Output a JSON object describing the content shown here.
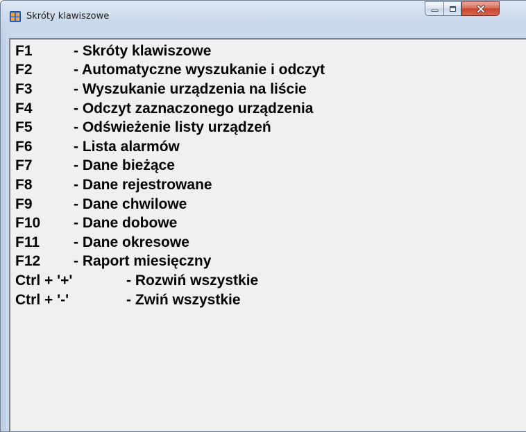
{
  "window": {
    "title": "Skróty klawiszowe",
    "icon": "app-window-icon"
  },
  "caption_buttons": {
    "minimize": "minimize-icon",
    "maximize": "maximize-icon",
    "close": "close-icon"
  },
  "shortcuts": [
    {
      "key": "F1",
      "description": "- Skróty klawiszowe"
    },
    {
      "key": "F2",
      "description": "- Automatyczne wyszukanie i odczyt"
    },
    {
      "key": "F3",
      "description": "- Wyszukanie urządzenia na liście"
    },
    {
      "key": "F4",
      "description": "- Odczyt zaznaczonego urządzenia"
    },
    {
      "key": "F5",
      "description": "- Odświeżenie listy urządzeń"
    },
    {
      "key": "F6",
      "description": "- Lista alarmów"
    },
    {
      "key": "F7",
      "description": "- Dane bieżące"
    },
    {
      "key": "F8",
      "description": "- Dane rejestrowane"
    },
    {
      "key": "F9",
      "description": "- Dane chwilowe"
    },
    {
      "key": "F10",
      "description": "- Dane dobowe"
    },
    {
      "key": "F11",
      "description": "- Dane okresowe"
    },
    {
      "key": "F12",
      "description": "- Raport miesięczny"
    },
    {
      "key": "Ctrl + '+'",
      "description": "- Rozwiń wszystkie"
    },
    {
      "key": "Ctrl + '-'",
      "description": "- Zwiń wszystkie"
    }
  ],
  "colors": {
    "titlebar": "#c9d8eb",
    "content_background": "#f0f0f0",
    "text": "#000000",
    "close_button": "#c7452f"
  }
}
